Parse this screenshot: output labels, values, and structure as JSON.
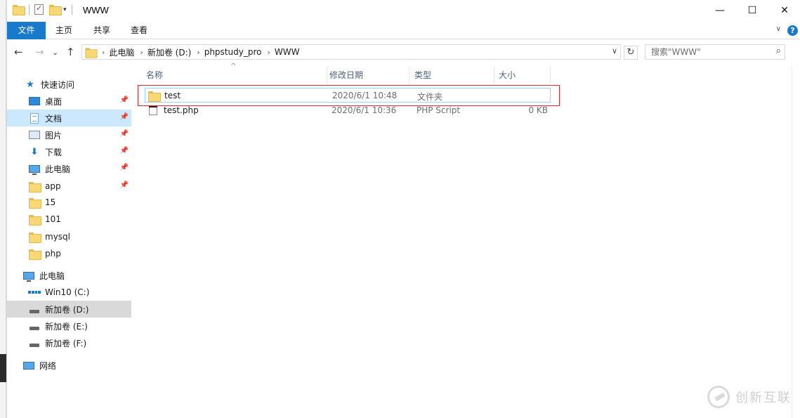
{
  "window": {
    "title": "WWW",
    "minimize": "—",
    "maximize": "☐",
    "close": "✕"
  },
  "ribbon": {
    "tabs": [
      "文件",
      "主页",
      "共享",
      "查看"
    ],
    "collapse_icon": "chevron-down",
    "help": "?"
  },
  "nav": {
    "back": "←",
    "forward": "→",
    "recent": "⌄",
    "up": "↑",
    "breadcrumb": [
      "此电脑",
      "新加卷 (D:)",
      "phpstudy_pro",
      "WWW"
    ],
    "refresh": "↻",
    "search_placeholder": "搜索\"WWW\""
  },
  "sidebar": {
    "quick_access": "快速访问",
    "items": [
      {
        "label": "桌面",
        "icon": "desktop-icon",
        "pinned": true
      },
      {
        "label": "文档",
        "icon": "documents-icon",
        "pinned": true,
        "selected": true
      },
      {
        "label": "图片",
        "icon": "pictures-icon",
        "pinned": true
      },
      {
        "label": "下载",
        "icon": "downloads-icon",
        "pinned": true
      },
      {
        "label": "此电脑",
        "icon": "this-pc-icon",
        "pinned": true
      },
      {
        "label": "app",
        "icon": "folder-icon",
        "pinned": true
      },
      {
        "label": "15",
        "icon": "folder-icon"
      },
      {
        "label": "101",
        "icon": "folder-icon"
      },
      {
        "label": "mysql",
        "icon": "folder-icon"
      },
      {
        "label": "php",
        "icon": "folder-icon"
      }
    ],
    "this_pc": "此电脑",
    "drives": [
      {
        "label": "Win10 (C:)"
      },
      {
        "label": "新加卷 (D:)",
        "highlighted": true
      },
      {
        "label": "新加卷 (E:)"
      },
      {
        "label": "新加卷 (F:)"
      }
    ],
    "network": "网络"
  },
  "columns": [
    "名称",
    "修改日期",
    "类型",
    "大小"
  ],
  "files": [
    {
      "name": "test",
      "date": "2020/6/1 10:48",
      "type": "文件夹",
      "size": "",
      "icon": "folder-icon",
      "selected": true
    },
    {
      "name": "test.php",
      "date": "2020/6/1 10:36",
      "type": "PHP Script",
      "size": "0 KB",
      "icon": "php-file-icon"
    }
  ],
  "watermark": "创新互联",
  "colors": {
    "accent": "#1979ca",
    "selection": "#cce8ff",
    "highlight_box": "#e0262b"
  }
}
